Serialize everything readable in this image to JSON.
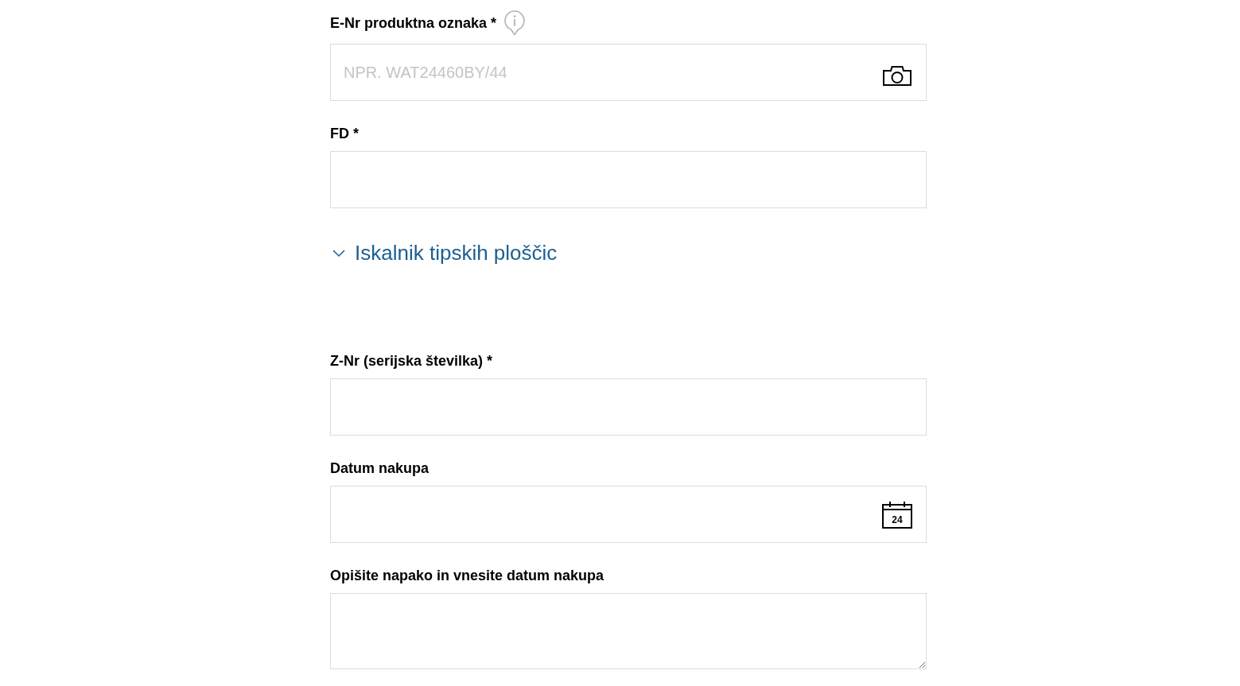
{
  "form": {
    "items": [
      {
        "kind": "scan",
        "label": "E-Nr produktna oznaka *",
        "info": true,
        "placeholder": "NPR. WAT24460BY/44"
      },
      {
        "kind": "text",
        "label": "FD *"
      },
      {
        "kind": "expander",
        "label": "Iskalnik tipskih ploščic",
        "expanded": false
      },
      {
        "kind": "text",
        "label": "Z-Nr (serijska številka) *"
      },
      {
        "kind": "date",
        "label": "Datum nakupa",
        "calendar_day": "24"
      },
      {
        "kind": "textarea",
        "label": "Opišite napako in vnesite datum nakupa"
      }
    ]
  }
}
